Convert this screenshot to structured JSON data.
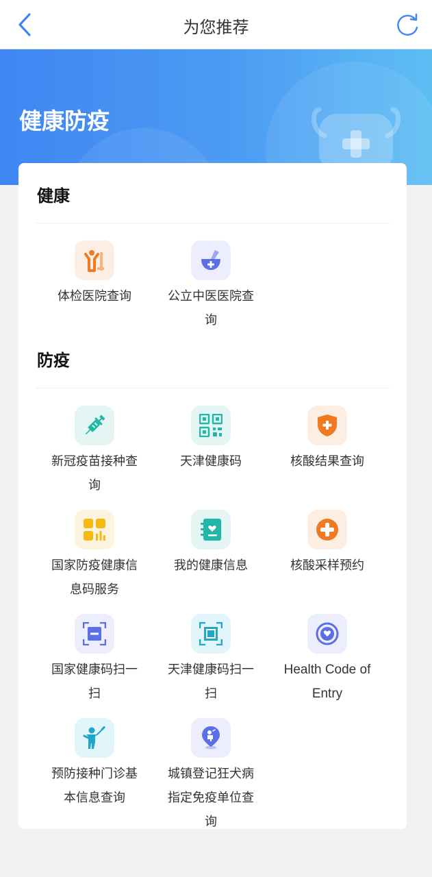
{
  "header": {
    "title": "为您推荐"
  },
  "banner": {
    "title": "健康防疫"
  },
  "sections": [
    {
      "title": "健康",
      "items": [
        {
          "label": "体检医院查询",
          "icon": "hospital-checkup-icon"
        },
        {
          "label": "公立中医医院查询",
          "icon": "tcm-mortar-icon"
        }
      ]
    },
    {
      "title": "防疫",
      "items": [
        {
          "label": "新冠疫苗接种查询",
          "icon": "vaccine-syringe-icon"
        },
        {
          "label": "天津健康码",
          "icon": "qr-code-icon"
        },
        {
          "label": "核酸结果查询",
          "icon": "shield-plus-icon"
        },
        {
          "label": "国家防疫健康信息码服务",
          "icon": "grid-code-icon"
        },
        {
          "label": "我的健康信息",
          "icon": "health-record-icon"
        },
        {
          "label": "核酸采样预约",
          "icon": "medical-cross-icon"
        },
        {
          "label": "国家健康码扫一扫",
          "icon": "scan-icon"
        },
        {
          "label": "天津健康码扫一扫",
          "icon": "scan-frame-icon"
        },
        {
          "label": "Health Code of Entry",
          "icon": "heart-badge-icon"
        },
        {
          "label": "预防接种门诊基本信息查询",
          "icon": "child-vaccination-icon"
        },
        {
          "label": "城镇登记狂犬病指定免疫单位查询",
          "icon": "rabies-location-icon"
        }
      ]
    }
  ],
  "colors": {
    "primary": "#3f86f2",
    "banner_end": "#5dbef3",
    "orange": "#f07a22",
    "teal": "#22b6a8",
    "indigo": "#5b6fe6",
    "yellow": "#f6b90f"
  }
}
